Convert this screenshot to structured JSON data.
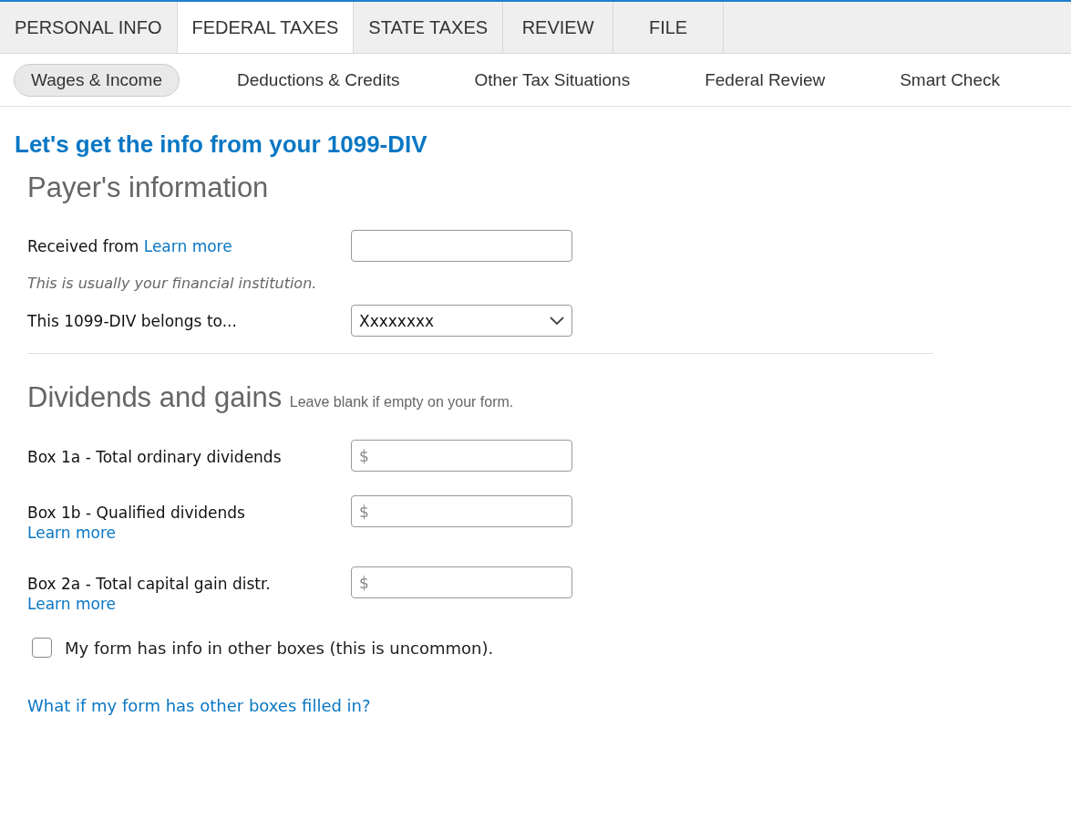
{
  "tabs": [
    {
      "label": "PERSONAL INFO",
      "selected": false
    },
    {
      "label": "FEDERAL TAXES",
      "selected": true
    },
    {
      "label": "STATE TAXES",
      "selected": false
    },
    {
      "label": "REVIEW",
      "selected": false
    },
    {
      "label": "FILE",
      "selected": false
    }
  ],
  "subtabs": [
    {
      "label": "Wages & Income",
      "selected": true
    },
    {
      "label": "Deductions & Credits",
      "selected": false
    },
    {
      "label": "Other Tax Situations",
      "selected": false
    },
    {
      "label": "Federal Review",
      "selected": false
    },
    {
      "label": "Smart Check",
      "selected": false
    }
  ],
  "heading": "Let's get the info from your 1099-DIV",
  "payer_section": {
    "title": "Payer's information",
    "fields": [
      {
        "kind": "text",
        "label": "Received from",
        "link": "Learn more"
      },
      {
        "kind": "note",
        "text": "This is usually your financial institution."
      },
      {
        "kind": "select",
        "label": "This 1099-DIV belongs to...",
        "value": "Xxxxxxxx"
      }
    ]
  },
  "dividends_section": {
    "title": "Dividends and gains",
    "subtitle": "Leave blank if empty on your form.",
    "fields": [
      {
        "label": "Box 1a - Total ordinary dividends",
        "placeholder": "$"
      },
      {
        "label": "Box 1b - Qualified dividends",
        "link": "Learn more",
        "placeholder": "$"
      },
      {
        "label": "Box 2a - Total capital gain distr.",
        "link": "Learn more",
        "placeholder": "$"
      }
    ],
    "checkbox": {
      "label": "My form has info in other boxes (this is uncommon).",
      "checked": false
    }
  },
  "footer_link": "What if my form has other boxes filled in?"
}
